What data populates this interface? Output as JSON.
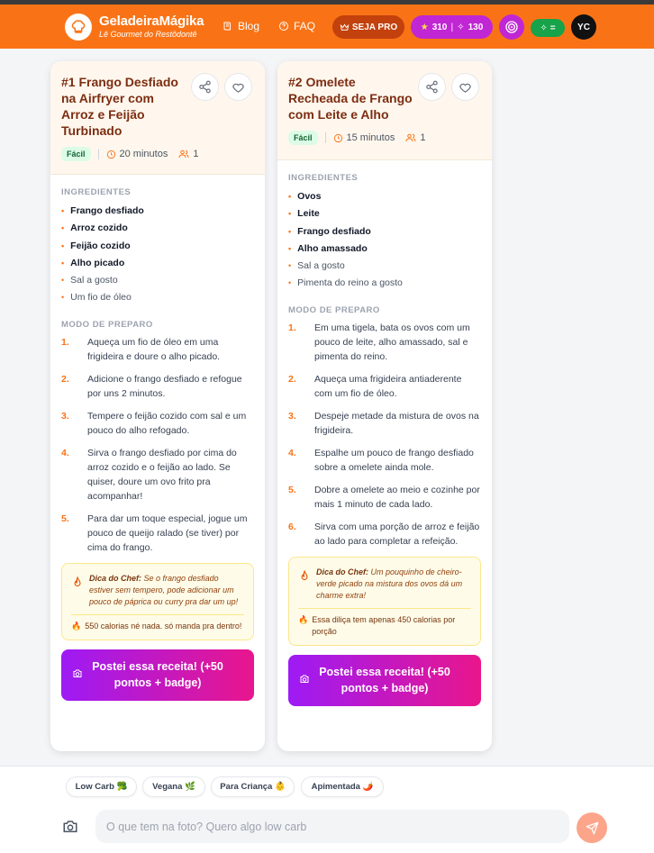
{
  "header": {
    "brand_name": "GeladeiraMágika",
    "brand_tagline": "Lê Gourmet do Restôdontê",
    "nav_blog": "Blog",
    "nav_faq": "FAQ",
    "pro_label": "SEJA PRO",
    "points": "310",
    "streak": "130",
    "green_badge": "=",
    "avatar_initials": "YC",
    "color_header": "#f97316"
  },
  "recipes": [
    {
      "title": "#1 Frango Desfiado na Airfryer com Arroz e Feijão Turbinado",
      "difficulty": "Fácil",
      "time": "20 minutos",
      "servings": "1",
      "ingredients_title": "INGREDIENTES",
      "ingredients": [
        "Frango desfiado",
        "Arroz cozido",
        "Feijão cozido",
        "Alho picado",
        "Sal a gosto",
        "Um fio de óleo"
      ],
      "method_title": "MODO DE PREPARO",
      "steps": [
        {
          "num": "1.",
          "text": "Aqueça um fio de óleo em uma frigideira e doure o alho picado."
        },
        {
          "num": "2.",
          "text": "Adicione o frango desfiado e refogue por uns 2 minutos."
        },
        {
          "num": "3.",
          "text": "Tempere o feijão cozido com sal e um pouco do alho refogado."
        },
        {
          "num": "4.",
          "text": "Sirva o frango desfiado por cima do arroz cozido e o feijão ao lado. Se quiser, doure um ovo frito pra acompanhar!"
        },
        {
          "num": "5.",
          "text": "Para dar um toque especial, jogue um pouco de queijo ralado (se tiver) por cima do frango."
        }
      ],
      "tip_label": "Dica do Chef:",
      "tip_text": "Se o frango desfiado estiver sem tempero, pode adicionar um pouco de páprica ou curry pra dar um up!",
      "calories": "550 calorias né nada. só manda pra dentro!",
      "post_label": "Postei essa receita! (+50 pontos + badge)"
    },
    {
      "title": "#2 Omelete Recheada de Frango com Leite e Alho",
      "difficulty": "Fácil",
      "time": "15 minutos",
      "servings": "1",
      "ingredients_title": "INGREDIENTES",
      "ingredients": [
        "Ovos",
        "Leite",
        "Frango desfiado",
        "Alho amassado",
        "Sal a gosto",
        "Pimenta do reino a gosto"
      ],
      "method_title": "MODO DE PREPARO",
      "steps": [
        {
          "num": "1.",
          "text": "Em uma tigela, bata os ovos com um pouco de leite, alho amassado, sal e pimenta do reino."
        },
        {
          "num": "2.",
          "text": "Aqueça uma frigideira antiaderente com um fio de óleo."
        },
        {
          "num": "3.",
          "text": "Despeje metade da mistura de ovos na frigideira."
        },
        {
          "num": "4.",
          "text": "Espalhe um pouco de frango desfiado sobre a omelete ainda mole."
        },
        {
          "num": "5.",
          "text": "Dobre a omelete ao meio e cozinhe por mais 1 minuto de cada lado."
        },
        {
          "num": "6.",
          "text": "Sirva com uma porção de arroz e feijão ao lado para completar a refeição."
        }
      ],
      "tip_label": "Dica do Chef:",
      "tip_text": "Um pouquinho de cheiro-verde picado na mistura dos ovos dá um charme extra!",
      "calories": "Essa diliça tem apenas 450 calorias por porção",
      "post_label": "Postei essa receita! (+50 pontos + badge)"
    }
  ],
  "chips": [
    "Low Carb 🥦",
    "Vegana 🌿",
    "Para Criança 👶",
    "Apimentada 🌶️"
  ],
  "chat": {
    "placeholder": "O que tem na foto? Quero algo low carb"
  }
}
